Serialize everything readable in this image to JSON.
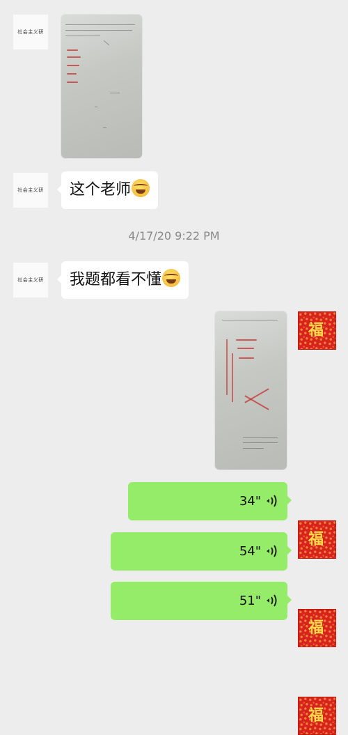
{
  "contacts": {
    "other_avatar_text": "社会主义研",
    "me_avatar_char": "福"
  },
  "timestamp": "4/17/20 9:22 PM",
  "messages": {
    "text1": "这个老师",
    "text2": "我题都看不懂"
  },
  "voice_messages": [
    {
      "duration": "34\""
    },
    {
      "duration": "54\""
    },
    {
      "duration": "51\""
    }
  ],
  "colors": {
    "background": "#ededed",
    "my_bubble": "#95ec69",
    "their_bubble": "#ffffff",
    "avatar_red": "#d8221d"
  },
  "icons": {
    "voice": "voice-wave-icon",
    "emoji": "crying-laughing-emoji"
  }
}
